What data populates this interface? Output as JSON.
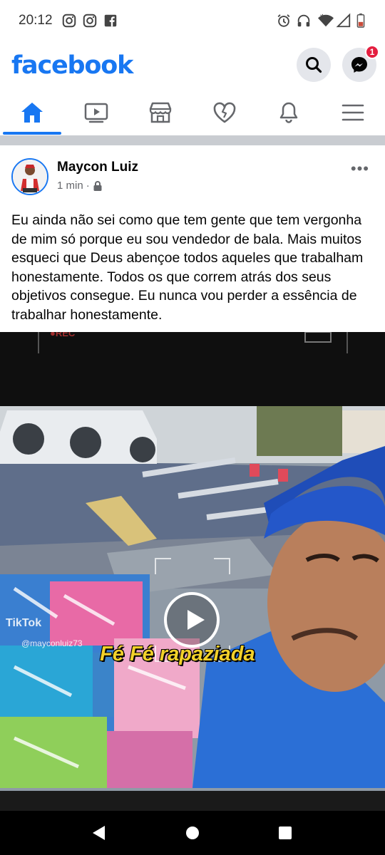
{
  "status_bar": {
    "time": "20:12",
    "left_icons": [
      "instagram-icon",
      "instagram-icon",
      "facebook-icon"
    ],
    "right_icons": [
      "alarm-icon",
      "headset-icon",
      "wifi-icon",
      "signal-icon",
      "battery-icon"
    ]
  },
  "header": {
    "logo": "facebook",
    "messenger_badge": "1",
    "brand_color": "#1877f2"
  },
  "nav": {
    "active": "home",
    "items": [
      "home-icon",
      "video-icon",
      "marketplace-icon",
      "dating-heart-icon",
      "notifications-bell-icon",
      "menu-icon"
    ]
  },
  "post": {
    "author": "Maycon Luiz",
    "time": "1 min",
    "separator": "·",
    "privacy_icon": "lock-icon",
    "more": "•••",
    "text": "Eu ainda não sei como que tem gente que tem vergonha de mim só porque eu sou vendedor de bala. Mais muitos esqueci que Deus abençoe todos aqueles que trabalham honestamente. Todos os que correm atrás dos seus objetivos consegue. Eu nunca vou perder a essência de trabalhar honestamente."
  },
  "video": {
    "caption": "Fé Fé rapaziada",
    "watermark": "TikTok",
    "watermark_handle": "@mayconluiz73",
    "rec_label": "●REC"
  }
}
